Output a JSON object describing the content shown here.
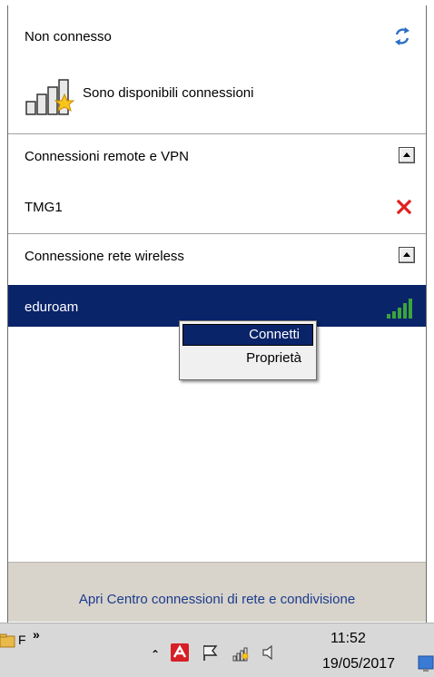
{
  "header": {
    "status": "Non connesso",
    "available": "Sono disponibili connessioni",
    "refresh_icon": "refresh-arrows-icon",
    "signal_icon": "network-signal-star-icon"
  },
  "sections": {
    "remote": {
      "title": "Connessioni remote e VPN",
      "items": [
        {
          "label": "TMG1",
          "icon": "x-icon"
        }
      ]
    },
    "wireless": {
      "title": "Connessione rete wireless",
      "items": [
        {
          "label": "eduroam",
          "selected": true,
          "icon": "wifi-signal-icon"
        }
      ]
    }
  },
  "context_menu": {
    "items": [
      {
        "label": "Connetti",
        "active": true
      },
      {
        "label": "Proprietà",
        "active": false
      }
    ]
  },
  "footer": {
    "link": "Apri Centro connessioni di rete e condivisione"
  },
  "taskbar": {
    "item_letter": "F",
    "overflow": "»",
    "tray_expand": "⌃",
    "time": "11:52",
    "date": "19/05/2017"
  },
  "colors": {
    "selection": "#0a246a",
    "link": "#1b3b8c",
    "error_x": "#e02020",
    "signal_green": "#3aa53a",
    "footer_bg": "#d8d4cc"
  }
}
